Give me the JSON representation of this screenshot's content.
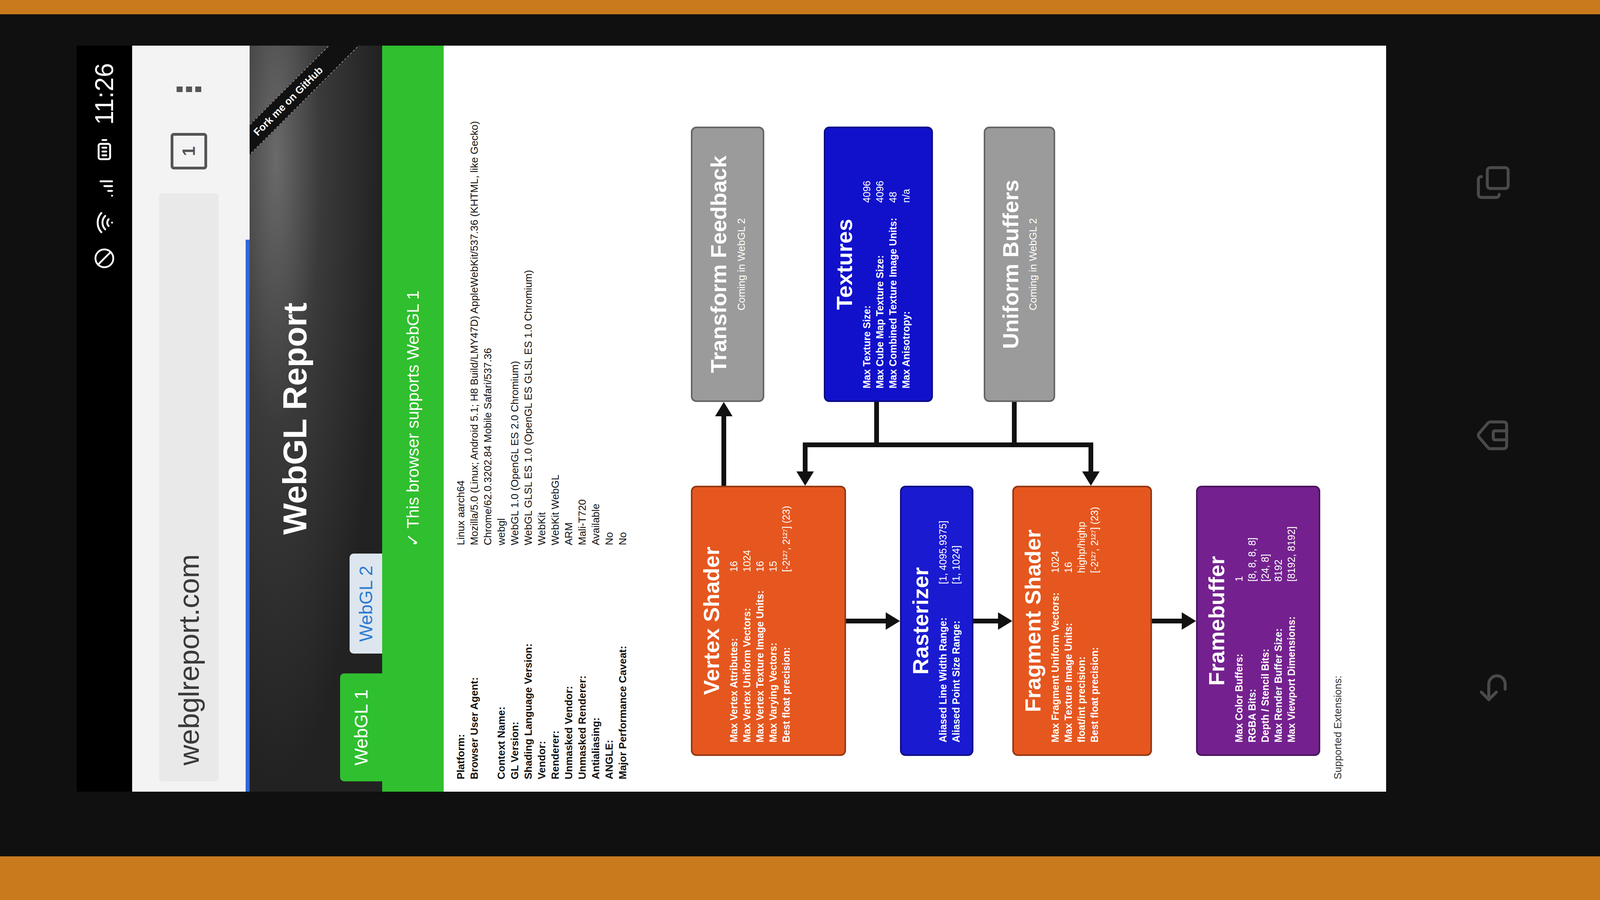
{
  "status_bar": {
    "time": "11:26"
  },
  "browser": {
    "url": "webglreport.com",
    "tab_count": "1",
    "menu": "⋮",
    "progress": 0.74
  },
  "page": {
    "title": "WebGL Report",
    "ribbon": "Fork me on GitHub",
    "tabs": [
      {
        "label": "WebGL 1",
        "selected": true
      },
      {
        "label": "WebGL 2",
        "selected": false
      }
    ],
    "banner": "✓ This browser supports WebGL 1"
  },
  "info": [
    {
      "label": "Platform:",
      "value": "Linux aarch64"
    },
    {
      "label": "Browser User Agent:",
      "value": "Mozilla/5.0 (Linux; Android 5.1; H8 Build/LMY47D) AppleWebKit/537.36 (KHTML, like Gecko) Chrome/62.0.3202.84 Mobile Safari/537.36"
    },
    {
      "label": "Context Name:",
      "value": "webgl"
    },
    {
      "label": "GL Version:",
      "value": "WebGL 1.0 (OpenGL ES 2.0 Chromium)"
    },
    {
      "label": "Shading Language Version:",
      "value": "WebGL GLSL ES 1.0 (OpenGL ES GLSL ES 1.0 Chromium)"
    },
    {
      "label": "Vendor:",
      "value": "WebKit"
    },
    {
      "label": "Renderer:",
      "value": "WebKit WebGL"
    },
    {
      "label": "Unmasked Vendor:",
      "value": "ARM"
    },
    {
      "label": "Unmasked Renderer:",
      "value": "Mali-T720"
    },
    {
      "label": "Antialiasing:",
      "value": "Available"
    },
    {
      "label": "ANGLE:",
      "value": "No"
    },
    {
      "label": "Major Performance Caveat:",
      "value": "No"
    }
  ],
  "pipeline": [
    {
      "title": "Vertex Shader",
      "kind": "stage",
      "color": "#e5571f",
      "subtitle": "",
      "rows": [
        {
          "label": "Max Vertex Attributes:",
          "value": "16"
        },
        {
          "label": "Max Vertex Uniform Vectors:",
          "value": "1024"
        },
        {
          "label": "Max Vertex Texture Image Units:",
          "value": "16"
        },
        {
          "label": "Max Varying Vectors:",
          "value": "15"
        },
        {
          "label": "Best float precision:",
          "value": "[-2¹²⁷, 2¹²⁷] (23)"
        }
      ]
    },
    {
      "title": "Transform Feedback",
      "kind": "placeholder",
      "color": "#9b9b9b",
      "subtitle": "Coming in WebGL 2",
      "rows": []
    },
    {
      "title": "Textures",
      "kind": "stage",
      "color": "#1111cc",
      "subtitle": "",
      "rows": [
        {
          "label": "Max Texture Size:",
          "value": "4096"
        },
        {
          "label": "Max Cube Map Texture Size:",
          "value": "4096"
        },
        {
          "label": "Max Combined Texture Image Units:",
          "value": "48"
        },
        {
          "label": "Max Anisotropy:",
          "value": "n/a"
        }
      ]
    },
    {
      "title": "Rasterizer",
      "kind": "stage",
      "color": "#1a1ad0",
      "subtitle": "",
      "rows": [
        {
          "label": "Aliased Line Width Range:",
          "value": "[1, 4095.9375]"
        },
        {
          "label": "Aliased Point Size Range:",
          "value": "[1, 1024]"
        }
      ]
    },
    {
      "title": "Uniform Buffers",
      "kind": "placeholder",
      "color": "#9b9b9b",
      "subtitle": "Coming in WebGL 2",
      "rows": []
    },
    {
      "title": "Fragment Shader",
      "kind": "stage",
      "color": "#e5571f",
      "subtitle": "",
      "rows": [
        {
          "label": "Max Fragment Uniform Vectors:",
          "value": "1024"
        },
        {
          "label": "Max Texture Image Units:",
          "value": "16"
        },
        {
          "label": "float/int precision:",
          "value": "highp/highp"
        },
        {
          "label": "Best float precision:",
          "value": "[-2¹²⁷, 2¹²⁷] (23)"
        }
      ]
    },
    {
      "title": "Framebuffer",
      "kind": "stage",
      "color": "#74218f",
      "subtitle": "",
      "rows": [
        {
          "label": "Max Color Buffers:",
          "value": "1"
        },
        {
          "label": "RGBA Bits:",
          "value": "[8, 8, 8, 8]"
        },
        {
          "label": "Depth / Stencil Bits:",
          "value": "[24, 8]"
        },
        {
          "label": "Max Render Buffer Size:",
          "value": "8192"
        },
        {
          "label": "Max Viewport Dimensions:",
          "value": "[8192, 8192]"
        }
      ]
    }
  ],
  "extensions_label": "Supported Extensions:"
}
